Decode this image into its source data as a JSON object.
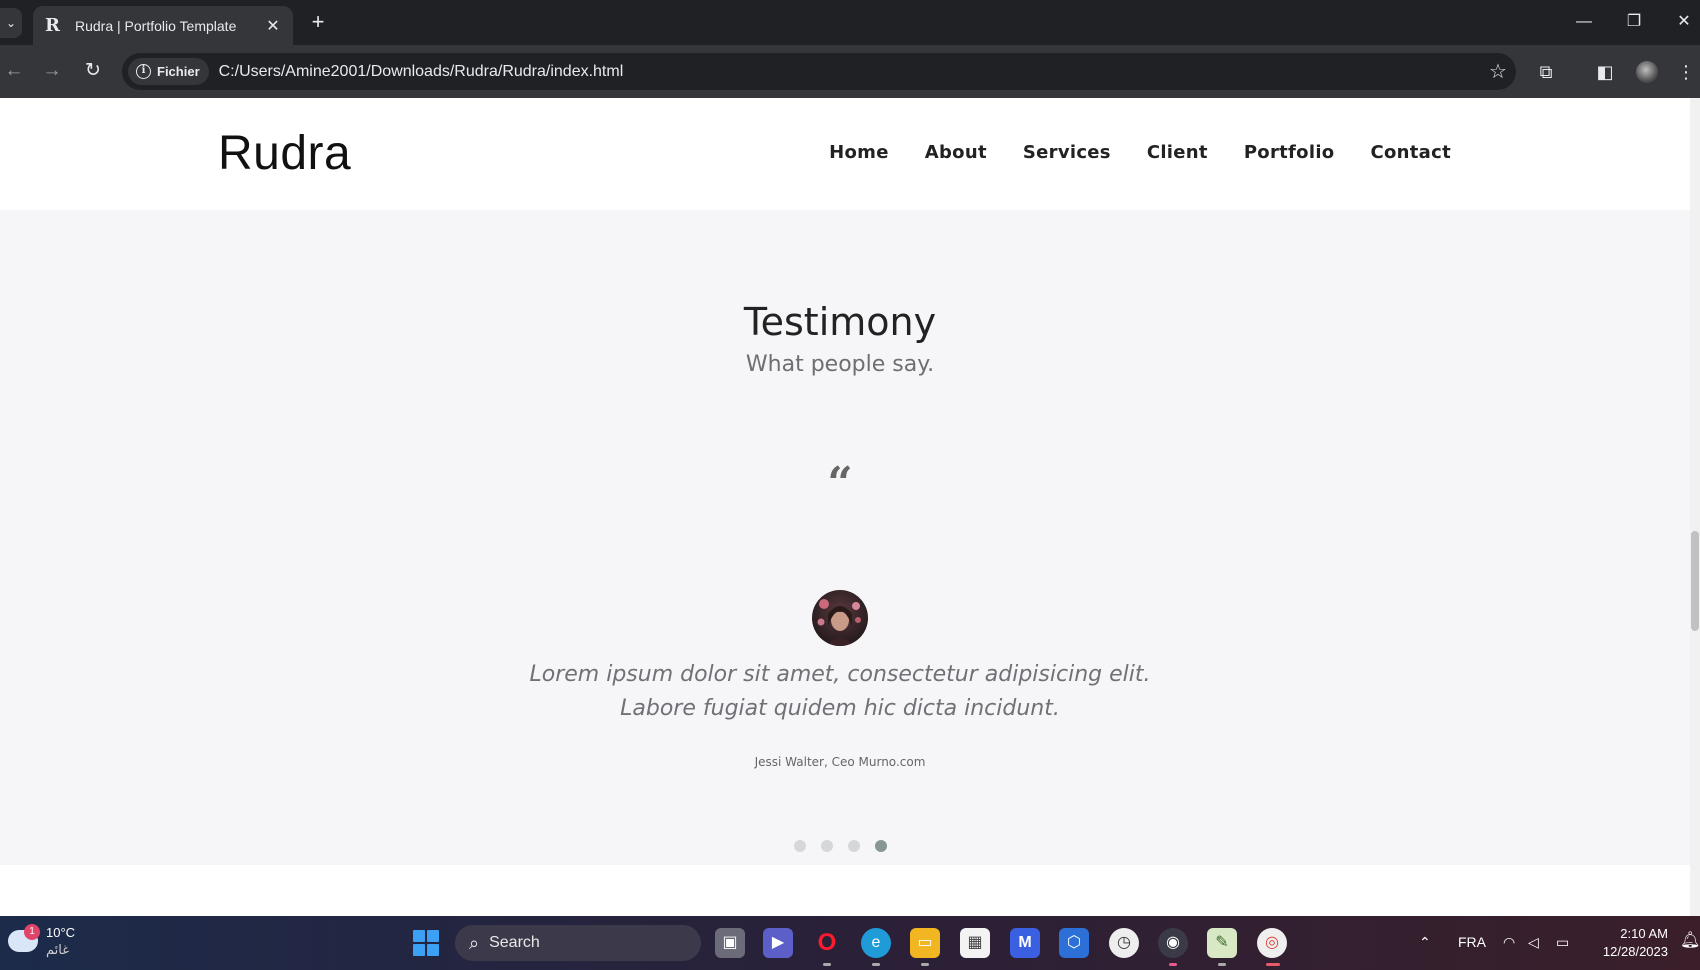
{
  "browser": {
    "tab_title": "Rudra | Portfolio Template",
    "favicon": "R",
    "chip_label": "Fichier",
    "url": "C:/Users/Amine2001/Downloads/Rudra/Rudra/index.html"
  },
  "site": {
    "brand": "Rudra",
    "nav": [
      "Home",
      "About",
      "Services",
      "Client",
      "Portfolio",
      "Contact"
    ]
  },
  "testimony": {
    "title": "Testimony",
    "subtitle": "What people say.",
    "quote_line1": "Lorem ipsum dolor sit amet, consectetur adipisicing elit.",
    "quote_line2": "Labore fugiat quidem hic dicta incidunt.",
    "author": "Jessi Walter, Ceo Murno.com",
    "dots_total": 4,
    "dots_active_index": 3
  },
  "taskbar": {
    "weather_temp": "10°C",
    "weather_cond": "غائم",
    "weather_badge": "1",
    "search_label": "Search",
    "language": "FRA",
    "time": "2:10 AM",
    "date": "12/28/2023"
  },
  "colors": {
    "chrome_dark": "#202124",
    "chrome_toolbar": "#35363a",
    "page_bg": "#f6f6f8",
    "dot_active": "#869791",
    "dot_inactive": "#d6d7d9"
  }
}
